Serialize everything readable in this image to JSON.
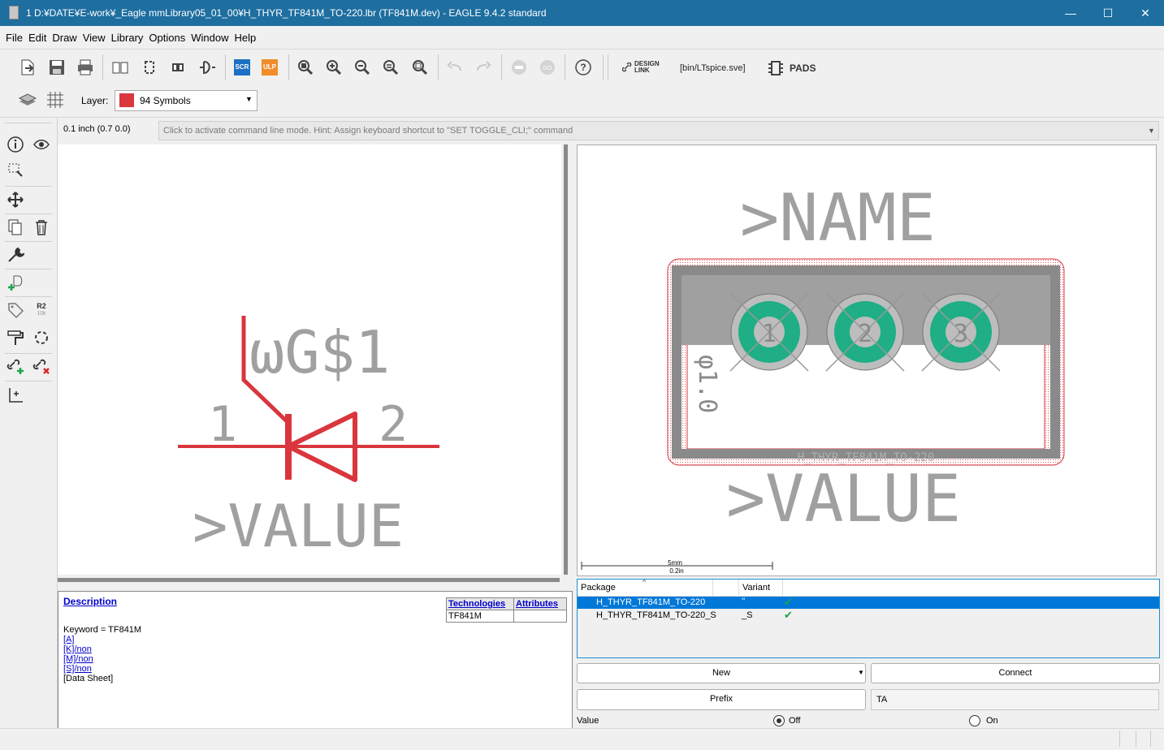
{
  "window": {
    "title": "1 D:¥DATE¥E-work¥_Eagle mmLibrary05_01_00¥H_THYR_TF841M_TO-220.lbr (TF841M.dev) - EAGLE 9.4.2 standard",
    "minimize": "—",
    "maximize": "☐",
    "close": "✕"
  },
  "menu": [
    "File",
    "Edit",
    "Draw",
    "View",
    "Library",
    "Options",
    "Window",
    "Help"
  ],
  "toolbar": {
    "scr_label": "SCR",
    "ulp_label": "ULP",
    "design_link": "DESIGN\nLINK",
    "ltspice": "[bin/LTspice.sve]",
    "pads": "PADS",
    "help_icon": "?"
  },
  "layer": {
    "label": "Layer:",
    "value": "94 Symbols",
    "color": "#d9363e"
  },
  "left_tools": {
    "r2_label": "R2",
    "r2_sub": "10k"
  },
  "command": {
    "coordinates": "0.1 inch (0.7 0.0)",
    "hint": "Click to activate command line mode. Hint: Assign keyboard shortcut to \"SET TOGGLE_CLI;\" command"
  },
  "symbol": {
    "name_text": "ωG$1",
    "pin1": "1",
    "pin2": "2",
    "value_text": ">VALUE"
  },
  "package_view": {
    "name_text": ">NAME",
    "value_text": ">VALUE",
    "pads": [
      "1",
      "2",
      "3"
    ],
    "hole_label": "φ1.0",
    "package_label": "H_THYR_TF841M_TO-220",
    "scale_mm": "5mm",
    "scale_in": "0.2in"
  },
  "description": {
    "heading": "Description",
    "lines": [
      "Keyword = TF841M",
      "[A]",
      "[K]/non",
      "[M]/non",
      "[S]/non",
      "[Data Sheet]"
    ],
    "tech_header": "Technologies",
    "attr_header": "Attributes",
    "tech_value": "TF841M"
  },
  "packages": {
    "col_package": "Package",
    "col_variant": "Variant",
    "rows": [
      {
        "package": "H_THYR_TF841M_TO-220",
        "variant": "''",
        "selected": true
      },
      {
        "package": "H_THYR_TF841M_TO-220_S",
        "variant": "_S",
        "selected": false
      }
    ]
  },
  "buttons": {
    "new": "New",
    "connect": "Connect",
    "prefix": "Prefix",
    "prefix_value": "TA",
    "value_label": "Value",
    "off": "Off",
    "on": "On"
  },
  "colors": {
    "titlebar": "#1e6ea0",
    "symbol_red": "#d9363e",
    "text_gray": "#a0a0a0",
    "pad_green": "#1fae85",
    "selection_blue": "#0078d7"
  }
}
